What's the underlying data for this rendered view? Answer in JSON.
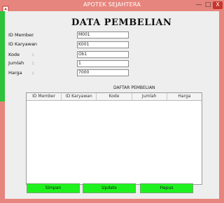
{
  "window": {
    "title": "APOTEK SEJAHTERA",
    "controls": {
      "minimize": "—",
      "maximize": "□",
      "close": "X"
    }
  },
  "heading": "DATA PEMBELIAN",
  "form": {
    "fields": [
      {
        "label": "ID Member",
        "value": "M001"
      },
      {
        "label": "ID Karyawan",
        "value": "K001"
      },
      {
        "label": "Kode",
        "value": "Ob1"
      },
      {
        "label": "Jumlah",
        "value": "1"
      },
      {
        "label": "Harga",
        "value": "7000"
      }
    ],
    "colon": ":"
  },
  "table": {
    "title": "DAFTAR PEMBELIAN",
    "columns": [
      "ID Member",
      "ID Karyawan",
      "Kode",
      "Jumlah",
      "Harga"
    ]
  },
  "buttons": {
    "save": "Simpan",
    "update": "Update",
    "delete": "Hapus"
  },
  "colors": {
    "window_frame": "#e6857d",
    "button_green": "#1ef21e",
    "close_red": "#c7342b"
  }
}
